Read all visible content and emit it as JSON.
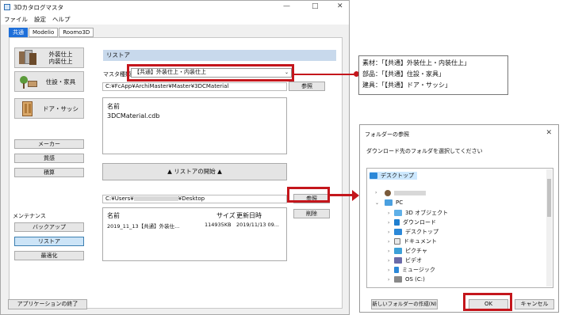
{
  "window": {
    "title": "3Dカタログマスタ",
    "minimize": "—",
    "maximize": "□",
    "close": "✕"
  },
  "menu": [
    "ファイル",
    "設定",
    "ヘルプ"
  ],
  "tabs": [
    "共通",
    "Modelio",
    "Roomo3D"
  ],
  "categories": [
    {
      "label": "外装仕上\n内装仕上",
      "icon": "wall-material-icon"
    },
    {
      "label": "住設・家具",
      "icon": "furniture-icon"
    },
    {
      "label": "ドア・サッシ",
      "icon": "door-icon"
    }
  ],
  "side_buttons": {
    "maker": "メーカー",
    "texture": "質感",
    "estimate": "積算"
  },
  "maintenance": {
    "title": "メンテナンス",
    "backup": "バックアップ",
    "restore": "リストア",
    "optimize": "最適化"
  },
  "exit_button": "アプリケーションの終了",
  "restore": {
    "header": "リストア",
    "master_type_label": "マスタ種類",
    "master_type_value": "【共通】外装仕上・内装仕上",
    "master_path": "C:¥FcApp¥ArchiMaster¥Master¥3DCMaterial",
    "browse": "参照",
    "list_header": "名前",
    "list_item": "3DCMaterial.cdb",
    "start_button": "▲ リストアの開始 ▲",
    "dest_path_prefix": "C:¥Users¥",
    "dest_path_suffix": "¥Desktop",
    "browse2": "参照",
    "delete": "削除",
    "file_cols": {
      "name": "名前",
      "size": "サイズ",
      "date": "更新日時"
    },
    "file_row": {
      "name": "2019_11_13【共通】外装仕...",
      "size": "114935KB",
      "date": "2019/11/13 09..."
    }
  },
  "callout": [
    "素材：「【共通】外装仕上・内装仕上」",
    "部品：「【共通】住設・家具」",
    "建具：「【共通】ドア・サッシ」"
  ],
  "folder_dialog": {
    "title": "フォルダーの参照",
    "close": "✕",
    "instruction": "ダウンロード先のフォルダを選択してください",
    "tree": {
      "desktop": "デスクトップ",
      "pc": "PC",
      "items": [
        "3D オブジェクト",
        "ダウンロード",
        "デスクトップ",
        "ドキュメント",
        "ピクチャ",
        "ビデオ",
        "ミュージック",
        "OS (C:)"
      ]
    },
    "new_folder": "新しいフォルダーの作成(N)",
    "ok": "OK",
    "cancel": "キャンセル"
  },
  "colors": {
    "accent": "#1e6fd9",
    "highlight": "#c4161c",
    "header_bg": "#c8d9ec"
  }
}
